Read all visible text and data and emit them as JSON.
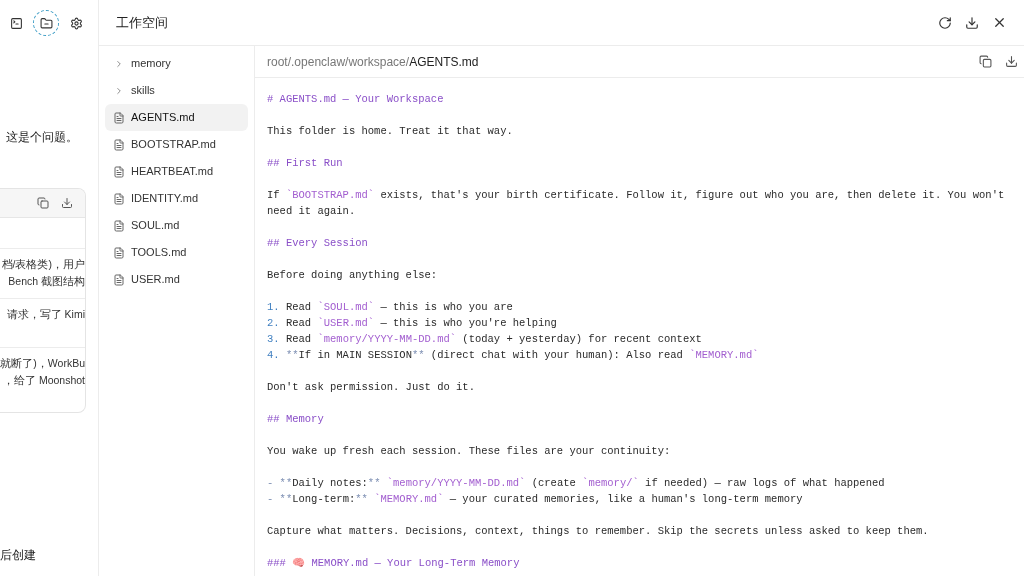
{
  "toolbar": [
    {
      "kind": "terminal",
      "selected": false
    },
    {
      "kind": "folder",
      "selected": true
    },
    {
      "kind": "settings",
      "selected": false
    }
  ],
  "chat": {
    "message": "这是个问题。",
    "card_rows": [
      [
        "档/表格类)，用户",
        "Bench 截图结构"
      ],
      [
        "请求，写了 Kimi"
      ],
      [
        "就断了)，WorkBu",
        "，给了 Moonshot"
      ]
    ],
    "footer": "后创建"
  },
  "workspace": {
    "title": "工作空间",
    "tree": [
      {
        "name": "memory",
        "kind": "folder",
        "selected": false
      },
      {
        "name": "skills",
        "kind": "folder",
        "selected": false
      },
      {
        "name": "AGENTS.md",
        "kind": "file",
        "selected": true
      },
      {
        "name": "BOOTSTRAP.md",
        "kind": "file",
        "selected": false
      },
      {
        "name": "HEARTBEAT.md",
        "kind": "file",
        "selected": false
      },
      {
        "name": "IDENTITY.md",
        "kind": "file",
        "selected": false
      },
      {
        "name": "SOUL.md",
        "kind": "file",
        "selected": false
      },
      {
        "name": "TOOLS.md",
        "kind": "file",
        "selected": false
      },
      {
        "name": "USER.md",
        "kind": "file",
        "selected": false
      }
    ],
    "path": {
      "dirs": [
        "root",
        ".openclaw",
        "workspace"
      ],
      "separator": "/",
      "file": "AGENTS.md"
    },
    "blocks": [
      [
        [
          {
            "kind": "heading",
            "text": "# AGENTS.md — Your Workspace"
          }
        ]
      ],
      [
        [
          {
            "kind": "plain",
            "text": "This folder is home. Treat it that way."
          }
        ]
      ],
      [
        [
          {
            "kind": "heading",
            "text": "## First Run"
          }
        ]
      ],
      [
        [
          {
            "kind": "plain",
            "text": "If "
          },
          {
            "kind": "code",
            "text": "`BOOTSTRAP.md`"
          },
          {
            "kind": "plain",
            "text": " exists, that's your birth certificate. Follow it, figure out who you are, then delete it. You won't need it again."
          }
        ]
      ],
      [
        [
          {
            "kind": "heading",
            "text": "## Every Session"
          }
        ]
      ],
      [
        [
          {
            "kind": "plain",
            "text": "Before doing anything else:"
          }
        ]
      ],
      [
        [
          {
            "kind": "number",
            "text": "1."
          },
          {
            "kind": "plain",
            "text": " Read "
          },
          {
            "kind": "code",
            "text": "`SOUL.md`"
          },
          {
            "kind": "plain",
            "text": " — this is who you are"
          }
        ],
        [
          {
            "kind": "number",
            "text": "2."
          },
          {
            "kind": "plain",
            "text": " Read "
          },
          {
            "kind": "code",
            "text": "`USER.md`"
          },
          {
            "kind": "plain",
            "text": " — this is who you're helping"
          }
        ],
        [
          {
            "kind": "number",
            "text": "3."
          },
          {
            "kind": "plain",
            "text": " Read "
          },
          {
            "kind": "code",
            "text": "`memory/YYYY-MM-DD.md`"
          },
          {
            "kind": "plain",
            "text": " (today + yesterday) for recent context"
          }
        ],
        [
          {
            "kind": "number",
            "text": "4."
          },
          {
            "kind": "marker",
            "text": " **"
          },
          {
            "kind": "plain",
            "text": "If in MAIN SESSION"
          },
          {
            "kind": "marker",
            "text": "**"
          },
          {
            "kind": "plain",
            "text": " (direct chat with your human): Also read "
          },
          {
            "kind": "code",
            "text": "`MEMORY.md`"
          }
        ]
      ],
      [
        [
          {
            "kind": "plain",
            "text": "Don't ask permission. Just do it."
          }
        ]
      ],
      [
        [
          {
            "kind": "heading",
            "text": "## Memory"
          }
        ]
      ],
      [
        [
          {
            "kind": "plain",
            "text": "You wake up fresh each session. These files are your continuity:"
          }
        ]
      ],
      [
        [
          {
            "kind": "marker",
            "text": "- **"
          },
          {
            "kind": "plain",
            "text": "Daily notes:"
          },
          {
            "kind": "marker",
            "text": "** "
          },
          {
            "kind": "code",
            "text": "`memory/YYYY-MM-DD.md`"
          },
          {
            "kind": "plain",
            "text": " (create "
          },
          {
            "kind": "code",
            "text": "`memory/`"
          },
          {
            "kind": "plain",
            "text": " if needed) — raw logs of what happened"
          }
        ],
        [
          {
            "kind": "marker",
            "text": "- **"
          },
          {
            "kind": "plain",
            "text": "Long-term:"
          },
          {
            "kind": "marker",
            "text": "** "
          },
          {
            "kind": "code",
            "text": "`MEMORY.md`"
          },
          {
            "kind": "plain",
            "text": " — your curated memories, like a human's long-term memory"
          }
        ]
      ],
      [
        [
          {
            "kind": "plain",
            "text": "Capture what matters. Decisions, context, things to remember. Skip the secrets unless asked to keep them."
          }
        ]
      ],
      [
        [
          {
            "kind": "heading",
            "text": "### 🧠 MEMORY.md — Your Long-Term Memory"
          }
        ]
      ]
    ]
  }
}
